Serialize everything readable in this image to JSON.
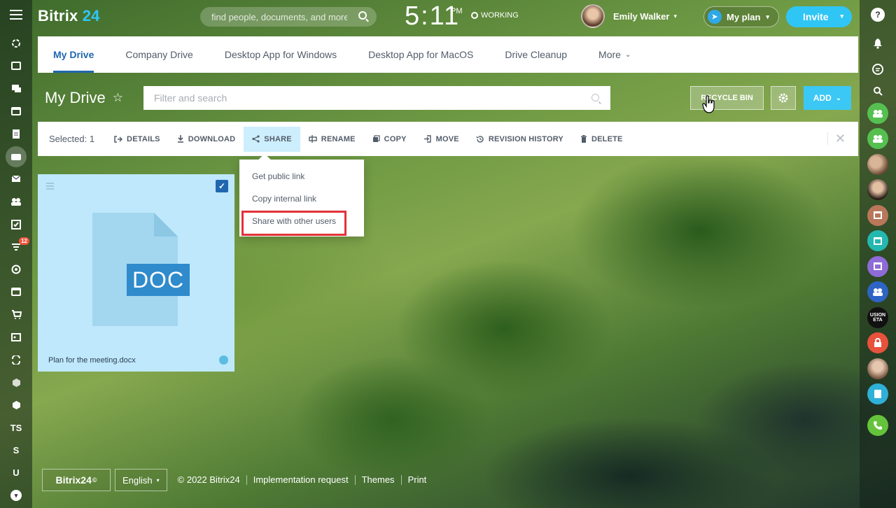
{
  "app": {
    "name": "Bitrix",
    "name_num": "24"
  },
  "header": {
    "search_placeholder": "find people, documents, and more",
    "clock_time": "5:11",
    "clock_ampm": "PM",
    "status": "WORKING",
    "user_name": "Emily Walker",
    "plan_label": "My plan",
    "invite_label": "Invite"
  },
  "tabs": [
    {
      "label": "My Drive"
    },
    {
      "label": "Company Drive"
    },
    {
      "label": "Desktop App for Windows"
    },
    {
      "label": "Desktop App for MacOS"
    },
    {
      "label": "Drive Cleanup"
    },
    {
      "label": "More"
    }
  ],
  "page": {
    "title": "My Drive",
    "filter_placeholder": "Filter and search",
    "recycle_label": "RECYCLE BIN",
    "add_label": "ADD"
  },
  "actions": {
    "selected_label": "Selected: 1",
    "items": [
      {
        "label": "DETAILS"
      },
      {
        "label": "DOWNLOAD"
      },
      {
        "label": "SHARE"
      },
      {
        "label": "RENAME"
      },
      {
        "label": "COPY"
      },
      {
        "label": "MOVE"
      },
      {
        "label": "REVISION HISTORY"
      },
      {
        "label": "DELETE"
      }
    ]
  },
  "share_menu": [
    {
      "label": "Get public link"
    },
    {
      "label": "Copy internal link"
    },
    {
      "label": "Share with other users"
    }
  ],
  "file": {
    "type_label": "DOC",
    "name": "Plan for the meeting.docx"
  },
  "left_rail": {
    "badge": "12",
    "ts_label": "TS",
    "s_label": "S",
    "u_label": "U"
  },
  "right_rail": {
    "fusion_label": "USION\nETA"
  },
  "footer": {
    "logo": "Bitrix24",
    "logo_mark": "©",
    "language": "English",
    "copyright": "© 2022 Bitrix24",
    "links": [
      "Implementation request",
      "Themes",
      "Print"
    ]
  },
  "colors": {
    "accent": "#2fc6f6",
    "active_tab": "#2067b0",
    "highlight_border": "#e23237"
  }
}
